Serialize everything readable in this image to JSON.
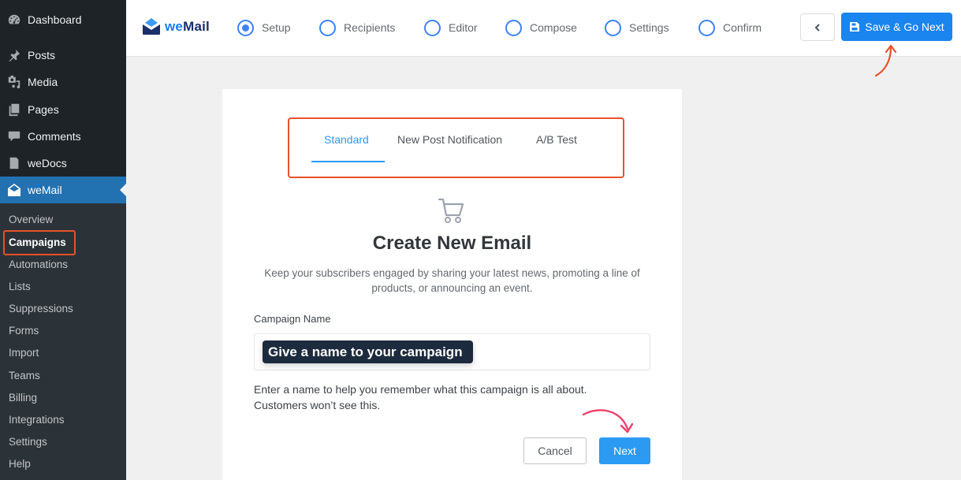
{
  "sidebar": {
    "menu": [
      {
        "label": "Dashboard",
        "icon": "dashboard-icon"
      },
      {
        "label": "Posts",
        "icon": "pin-icon"
      },
      {
        "label": "Media",
        "icon": "media-icon"
      },
      {
        "label": "Pages",
        "icon": "pages-icon"
      },
      {
        "label": "Comments",
        "icon": "comment-icon"
      },
      {
        "label": "weDocs",
        "icon": "document-icon"
      },
      {
        "label": "weMail",
        "icon": "envelope-icon",
        "active": true
      }
    ],
    "submenu": [
      {
        "label": "Overview"
      },
      {
        "label": "Campaigns",
        "current": true
      },
      {
        "label": "Automations"
      },
      {
        "label": "Lists"
      },
      {
        "label": "Suppressions"
      },
      {
        "label": "Forms"
      },
      {
        "label": "Import"
      },
      {
        "label": "Teams"
      },
      {
        "label": "Billing"
      },
      {
        "label": "Integrations"
      },
      {
        "label": "Settings"
      },
      {
        "label": "Help"
      }
    ]
  },
  "topbar": {
    "logo": {
      "we": "we",
      "mail": "Mail"
    },
    "steps": [
      {
        "label": "Setup",
        "selected": true
      },
      {
        "label": "Recipients",
        "selected": false
      },
      {
        "label": "Editor",
        "selected": false
      },
      {
        "label": "Compose",
        "selected": false
      },
      {
        "label": "Settings",
        "selected": false
      },
      {
        "label": "Confirm",
        "selected": false
      }
    ],
    "back_label": "‹",
    "save_label": "Save & Go Next"
  },
  "card": {
    "tabs": [
      {
        "label": "Standard",
        "active": true
      },
      {
        "label": "New Post Notification",
        "active": false
      },
      {
        "label": "A/B Test",
        "active": false
      }
    ],
    "title": "Create New Email",
    "description": "Keep your subscribers engaged by sharing your latest news, promoting a line of products, or announcing an event.",
    "field_label": "Campaign Name",
    "field_value": "",
    "tooltip": "Give a name to your campaign",
    "help_line1": "Enter a name to help you remember what this campaign is all about.",
    "help_line2": "Customers won’t see this.",
    "cancel_label": "Cancel",
    "next_label": "Next"
  },
  "colors": {
    "primary": "#1a84ef",
    "tab_active": "#2b9af3",
    "highlight": "#e8512a",
    "sidebar_bg": "#1d2327",
    "sidebar_active": "#2271b1"
  }
}
